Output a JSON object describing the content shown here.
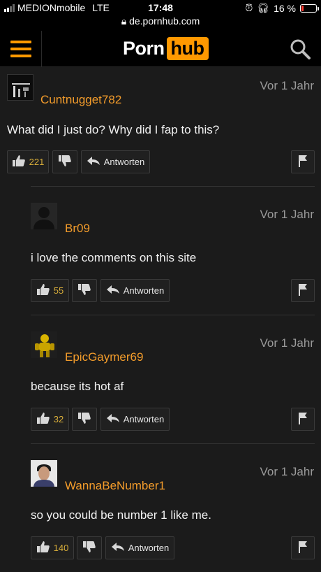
{
  "status_bar": {
    "carrier": "MEDIONmobile",
    "network": "LTE",
    "time": "17:48",
    "url": "de.pornhub.com",
    "battery": "16 %",
    "battery_color": "#ff3b30"
  },
  "header": {
    "logo_part1": "Porn",
    "logo_part2": "hub",
    "accent_color": "#ff9900",
    "menu_icon": "hamburger-menu-icon",
    "search_icon": "search-icon"
  },
  "comments": [
    {
      "username": "Cuntnugget782",
      "time": "Vor 1 Jahr",
      "text": "What did I just do? Why did I fap to this?",
      "likes": "221",
      "reply_label": "Antworten"
    },
    {
      "username": "Br09",
      "time": "Vor 1 Jahr",
      "text": "i love the comments on this site",
      "likes": "55",
      "reply_label": "Antworten"
    },
    {
      "username": "EpicGaymer69",
      "time": "Vor 1 Jahr",
      "text": "because its hot af",
      "likes": "32",
      "reply_label": "Antworten"
    },
    {
      "username": "WannaBeNumber1",
      "time": "Vor 1 Jahr",
      "text": "so you could be number 1 like me.",
      "likes": "140",
      "reply_label": "Antworten"
    }
  ]
}
